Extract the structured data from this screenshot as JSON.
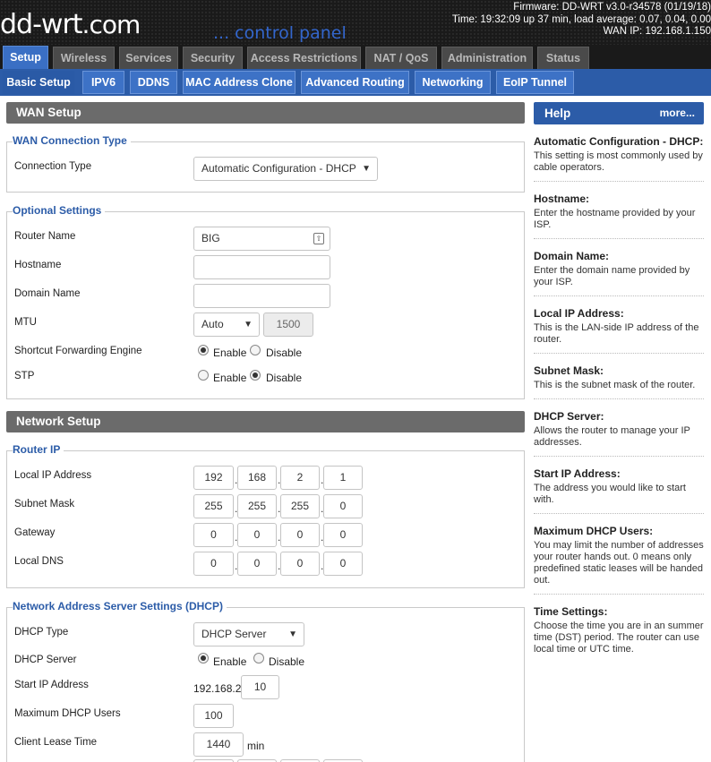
{
  "header": {
    "logo_main": "dd-wrt",
    "logo_com": ".com",
    "tagline": "... control panel",
    "firmware": "Firmware: DD-WRT v3.0-r34578 (01/19/18)",
    "time": "Time: 19:32:09 up 37 min, load average: 0.07, 0.04, 0.00",
    "wan_ip": "WAN IP: 192.168.1.150"
  },
  "tabs": [
    {
      "label": "Setup"
    },
    {
      "label": "Wireless"
    },
    {
      "label": "Services"
    },
    {
      "label": "Security"
    },
    {
      "label": "Access Restrictions"
    },
    {
      "label": "NAT / QoS"
    },
    {
      "label": "Administration"
    },
    {
      "label": "Status"
    }
  ],
  "subtabs": [
    {
      "label": "Basic Setup"
    },
    {
      "label": "IPV6"
    },
    {
      "label": "DDNS"
    },
    {
      "label": "MAC Address Clone"
    },
    {
      "label": "Advanced Routing"
    },
    {
      "label": "Networking"
    },
    {
      "label": "EoIP Tunnel"
    }
  ],
  "wan": {
    "title": "WAN Setup",
    "conn_legend": "WAN Connection Type",
    "conn_label": "Connection Type",
    "conn_value": "Automatic Configuration - DHCP",
    "opt_legend": "Optional Settings",
    "router_name_label": "Router Name",
    "router_name_value": "BIG",
    "hostname_label": "Hostname",
    "hostname_value": "",
    "domain_label": "Domain Name",
    "domain_value": "",
    "mtu_label": "MTU",
    "mtu_mode": "Auto",
    "mtu_value": "1500",
    "sfe_label": "Shortcut Forwarding Engine",
    "stp_label": "STP",
    "enable": "Enable",
    "disable": "Disable"
  },
  "network": {
    "title": "Network Setup",
    "router_ip_legend": "Router IP",
    "local_ip_label": "Local IP Address",
    "local_ip": [
      "192",
      "168",
      "2",
      "1"
    ],
    "subnet_label": "Subnet Mask",
    "subnet": [
      "255",
      "255",
      "255",
      "0"
    ],
    "gateway_label": "Gateway",
    "gateway": [
      "0",
      "0",
      "0",
      "0"
    ],
    "dns_label": "Local DNS",
    "dns": [
      "0",
      "0",
      "0",
      "0"
    ],
    "dhcp_legend": "Network Address Server Settings (DHCP)",
    "dhcp_type_label": "DHCP Type",
    "dhcp_type_value": "DHCP Server",
    "dhcp_server_label": "DHCP Server",
    "start_ip_label": "Start IP Address",
    "start_ip_prefix": "192.168.2.",
    "start_ip_value": "10",
    "max_users_label": "Maximum DHCP Users",
    "max_users_value": "100",
    "lease_label": "Client Lease Time",
    "lease_value": "1440",
    "lease_unit": "min",
    "dot": "."
  },
  "help": {
    "title": "Help",
    "more": "more...",
    "items": [
      {
        "title": "Automatic Configuration - DHCP:",
        "text": "This setting is most commonly used by cable operators."
      },
      {
        "title": "Hostname:",
        "text": "Enter the hostname provided by your ISP."
      },
      {
        "title": "Domain Name:",
        "text": "Enter the domain name provided by your ISP."
      },
      {
        "title": "Local IP Address:",
        "text": "This is the LAN-side IP address of the router."
      },
      {
        "title": "Subnet Mask:",
        "text": "This is the subnet mask of the router."
      },
      {
        "title": "DHCP Server:",
        "text": "Allows the router to manage your IP addresses."
      },
      {
        "title": "Start IP Address:",
        "text": "The address you would like to start with."
      },
      {
        "title": "Maximum DHCP Users:",
        "text": "You may limit the number of addresses your router hands out. 0 means only predefined static leases will be handed out."
      },
      {
        "title": "Time Settings:",
        "text": "Choose the time you are in an summer time (DST) period. The router can use local time or UTC time."
      }
    ]
  }
}
